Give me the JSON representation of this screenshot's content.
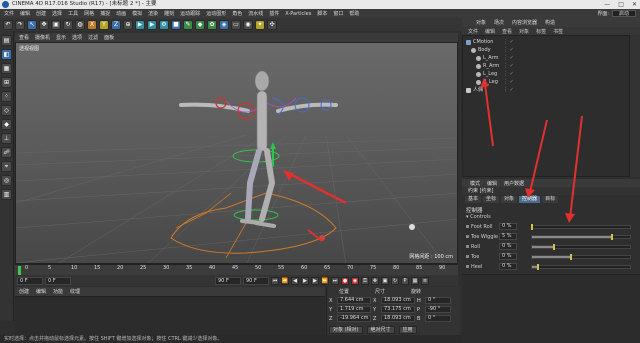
{
  "window": {
    "title": "CINEMA 4D R17.016 Studio (R17) - [未标题 2 *] - 主要",
    "controls": [
      "—",
      "□",
      "✕"
    ]
  },
  "menubar": {
    "items": [
      "文件",
      "编辑",
      "创建",
      "选择",
      "工具",
      "网格",
      "捕捉",
      "动画",
      "模拟",
      "渲染",
      "雕刻",
      "运动跟踪",
      "运动图形",
      "角色",
      "流水线",
      "插件",
      "X-Particles",
      "脚本",
      "窗口",
      "帮助"
    ],
    "layout_label": "界面:",
    "layout_value": "启动"
  },
  "viewport": {
    "menu": [
      "查看",
      "摄像机",
      "显示",
      "选项",
      "过滤",
      "面板"
    ],
    "camera_label": "透视视图",
    "grid_spacing": "网格间距 : 100 cm"
  },
  "timeline": {
    "ticks": [
      "0",
      "5",
      "10",
      "15",
      "20",
      "25",
      "30",
      "35",
      "40",
      "45",
      "50",
      "55",
      "60",
      "65",
      "70",
      "75",
      "80",
      "85",
      "90"
    ],
    "frame_label": "0 F",
    "current_frame": "0 F",
    "start_frame": "0 F",
    "end_frame": "90 F",
    "right_field": "90 F",
    "preview_end": "0 F"
  },
  "material_manager": {
    "menu": [
      "创建",
      "编辑",
      "功能",
      "纹理"
    ]
  },
  "coordinates": {
    "headers": [
      "位置",
      "尺寸",
      "旋转"
    ],
    "rows": [
      {
        "axis": "X",
        "pos": "7.644 cm",
        "size_axis": "X",
        "size": "18.093 cm",
        "rot_axis": "H",
        "rot": "0 °"
      },
      {
        "axis": "Y",
        "pos": "1.719 cm",
        "size_axis": "Y",
        "size": "73.175 cm",
        "rot_axis": "P",
        "rot": "-90 °"
      },
      {
        "axis": "Z",
        "pos": "-19.964 cm",
        "size_axis": "Z",
        "size": "18.093 cm",
        "rot_axis": "B",
        "rot": "0 °"
      }
    ],
    "mode_object": "对象 (相对)",
    "mode_size": "绝对尺寸",
    "apply_label": "应用"
  },
  "object_manager": {
    "tabs": [
      "对象",
      "场次",
      "内容浏览器",
      "构造"
    ],
    "menu": [
      "文件",
      "编辑",
      "查看",
      "对象",
      "标签",
      "书签"
    ],
    "objects": [
      {
        "name": "CMotion",
        "indent": 0
      },
      {
        "name": "Body",
        "indent": 1
      },
      {
        "name": "L_Arm",
        "indent": 2
      },
      {
        "name": "R_Arm",
        "indent": 2
      },
      {
        "name": "L_Leg",
        "indent": 2
      },
      {
        "name": "R_Leg",
        "indent": 2
      },
      {
        "name": "人偶",
        "indent": 0
      }
    ]
  },
  "attribute_manager": {
    "menu": [
      "模式",
      "编辑",
      "用户数据"
    ],
    "header": "约束 [约束]",
    "tabs": [
      "基本",
      "坐标",
      "对象",
      "控制器",
      "目标"
    ],
    "active_tab": "控制器",
    "section": "控制器",
    "subsection": "▾ Controls",
    "params": [
      {
        "label": "Foot Roll",
        "value": "0 %",
        "level": 0.0
      },
      {
        "label": "Toe Wiggle",
        "value": "5 %",
        "level": 0.82
      },
      {
        "label": "Roll",
        "value": "0 %",
        "level": 0.22
      },
      {
        "label": "Toe",
        "value": "0 %",
        "level": 0.4
      },
      {
        "label": "Heel",
        "value": "0 %",
        "level": 0.06
      }
    ]
  },
  "statusbar": {
    "text": "实时选择：点击并拖动鼠标选择元素。按住 SHIFT 键增加选择对象；按住 CTRL 键减少选择对象。"
  },
  "colors": {
    "accent_red": "#e03030",
    "timeline_cursor": "#3ec94e",
    "selection_blue": "#4d6b8a"
  }
}
